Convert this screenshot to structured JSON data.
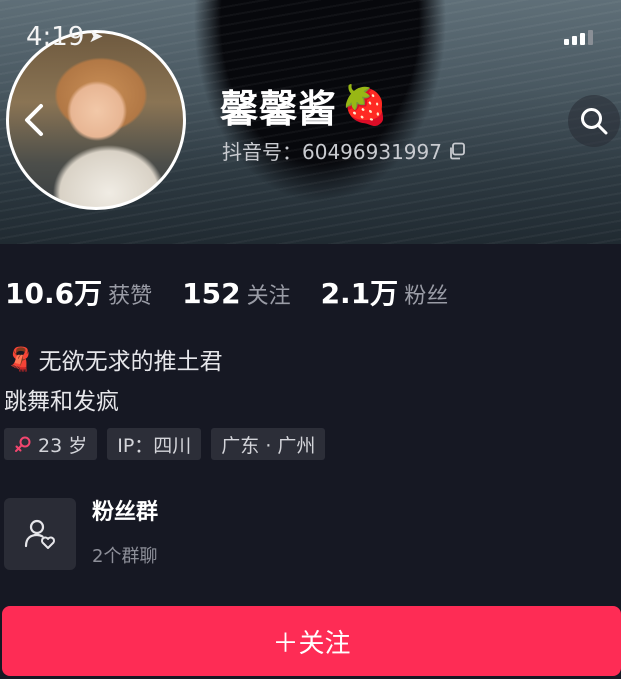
{
  "status_bar": {
    "time": "4:19",
    "location_arrow": "location-arrow-icon",
    "signal_icon": "signal-bars-icon"
  },
  "profile": {
    "nickname": "馨馨酱",
    "nickname_emoji": "🍓",
    "douyin_id": "抖音号：60496931997",
    "copy_icon": "copy-icon"
  },
  "stats": [
    {
      "value": "10.6万",
      "label": "获赞"
    },
    {
      "value": "152",
      "label": "关注"
    },
    {
      "value": "2.1万",
      "label": "粉丝"
    }
  ],
  "bio": {
    "line1_emoji": "🧣",
    "line1": "无欲无求的推土君",
    "line2": "跳舞和发疯"
  },
  "tags": [
    {
      "text": "23 岁",
      "icon": "female-icon",
      "icon_color": "#f3466f"
    },
    {
      "text": "IP：四川"
    },
    {
      "text": "广东 · 广州"
    }
  ],
  "fan_group": {
    "title": "粉丝群",
    "subtitle": "2个群聊",
    "icon": "fan-group-icon"
  },
  "follow_button": {
    "label": "＋关注",
    "color": "#fe2c55"
  },
  "colors": {
    "background": "#161823",
    "accent": "#fe2c55"
  }
}
